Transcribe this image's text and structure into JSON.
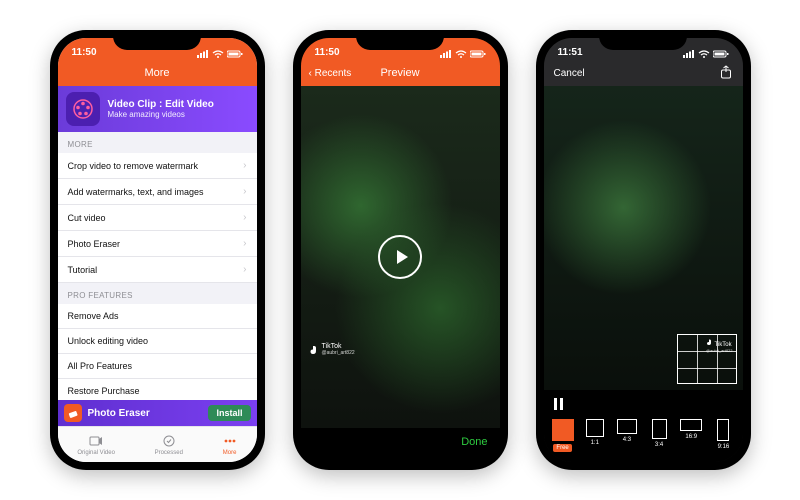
{
  "status": {
    "time": "11:50",
    "time3": "11:51"
  },
  "phone1": {
    "nav_title": "More",
    "promo": {
      "title": "Video Clip : Edit Video",
      "subtitle": "Make amazing videos"
    },
    "section_more": "MORE",
    "more_items": [
      "Crop video to remove watermark",
      "Add watermarks, text, and images",
      "Cut video",
      "Photo Eraser",
      "Tutorial"
    ],
    "section_pro": "PRO FEATURES",
    "pro_items": [
      "Remove Ads",
      "Unlock editing video",
      "All Pro Features",
      "Restore Purchase"
    ],
    "install_banner": {
      "label": "Photo Eraser",
      "button": "Install"
    },
    "tabs": {
      "original": "Original Video",
      "processed": "Processed",
      "more": "More"
    }
  },
  "phone2": {
    "back": "Recents",
    "nav_title": "Preview",
    "watermark": {
      "brand": "TikTok",
      "handle": "@aubri_art822"
    },
    "done": "Done"
  },
  "phone3": {
    "cancel": "Cancel",
    "watermark": {
      "brand": "TikTok",
      "handle": "@aubri_art822"
    },
    "ratios": {
      "free": "Free",
      "r11": "1:1",
      "r43": "4:3",
      "r34": "3:4",
      "r169": "16:9",
      "r916": "9:16"
    }
  }
}
